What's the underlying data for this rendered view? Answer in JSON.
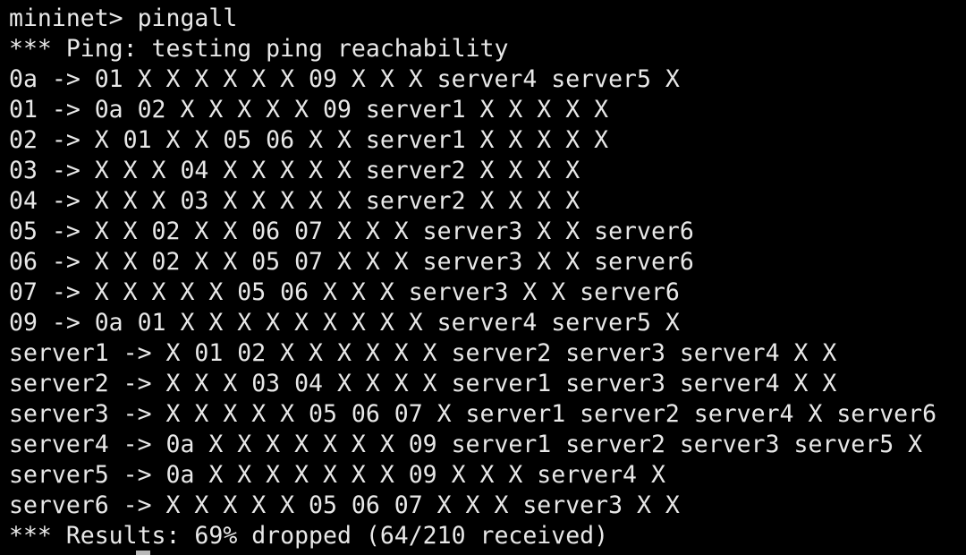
{
  "terminal": {
    "lines": [
      "mininet> pingall",
      "*** Ping: testing ping reachability",
      "0a -> 01 X X X X X X 09 X X X server4 server5 X",
      "01 -> 0a 02 X X X X X 09 server1 X X X X X",
      "02 -> X 01 X X 05 06 X X server1 X X X X X",
      "03 -> X X X 04 X X X X X server2 X X X X",
      "04 -> X X X 03 X X X X X server2 X X X X",
      "05 -> X X 02 X X 06 07 X X X server3 X X server6",
      "06 -> X X 02 X X 05 07 X X X server3 X X server6",
      "07 -> X X X X X 05 06 X X X server3 X X server6",
      "09 -> 0a 01 X X X X X X X X X server4 server5 X",
      "server1 -> X 01 02 X X X X X X server2 server3 server4 X X",
      "server2 -> X X X 03 04 X X X X server1 server3 server4 X X",
      "server3 -> X X X X X 05 06 07 X server1 server2 server4 X server6",
      "server4 -> 0a X X X X X X X 09 server1 server2 server3 server5 X",
      "server5 -> 0a X X X X X X X 09 X X X server4 X",
      "server6 -> X X X X X 05 06 07 X X X server3 X X",
      "*** Results: 69% dropped (64/210 received)"
    ],
    "colors": {
      "background": "#000000",
      "text": "#e8e8e8",
      "cursor": "#b8b8b8"
    }
  }
}
